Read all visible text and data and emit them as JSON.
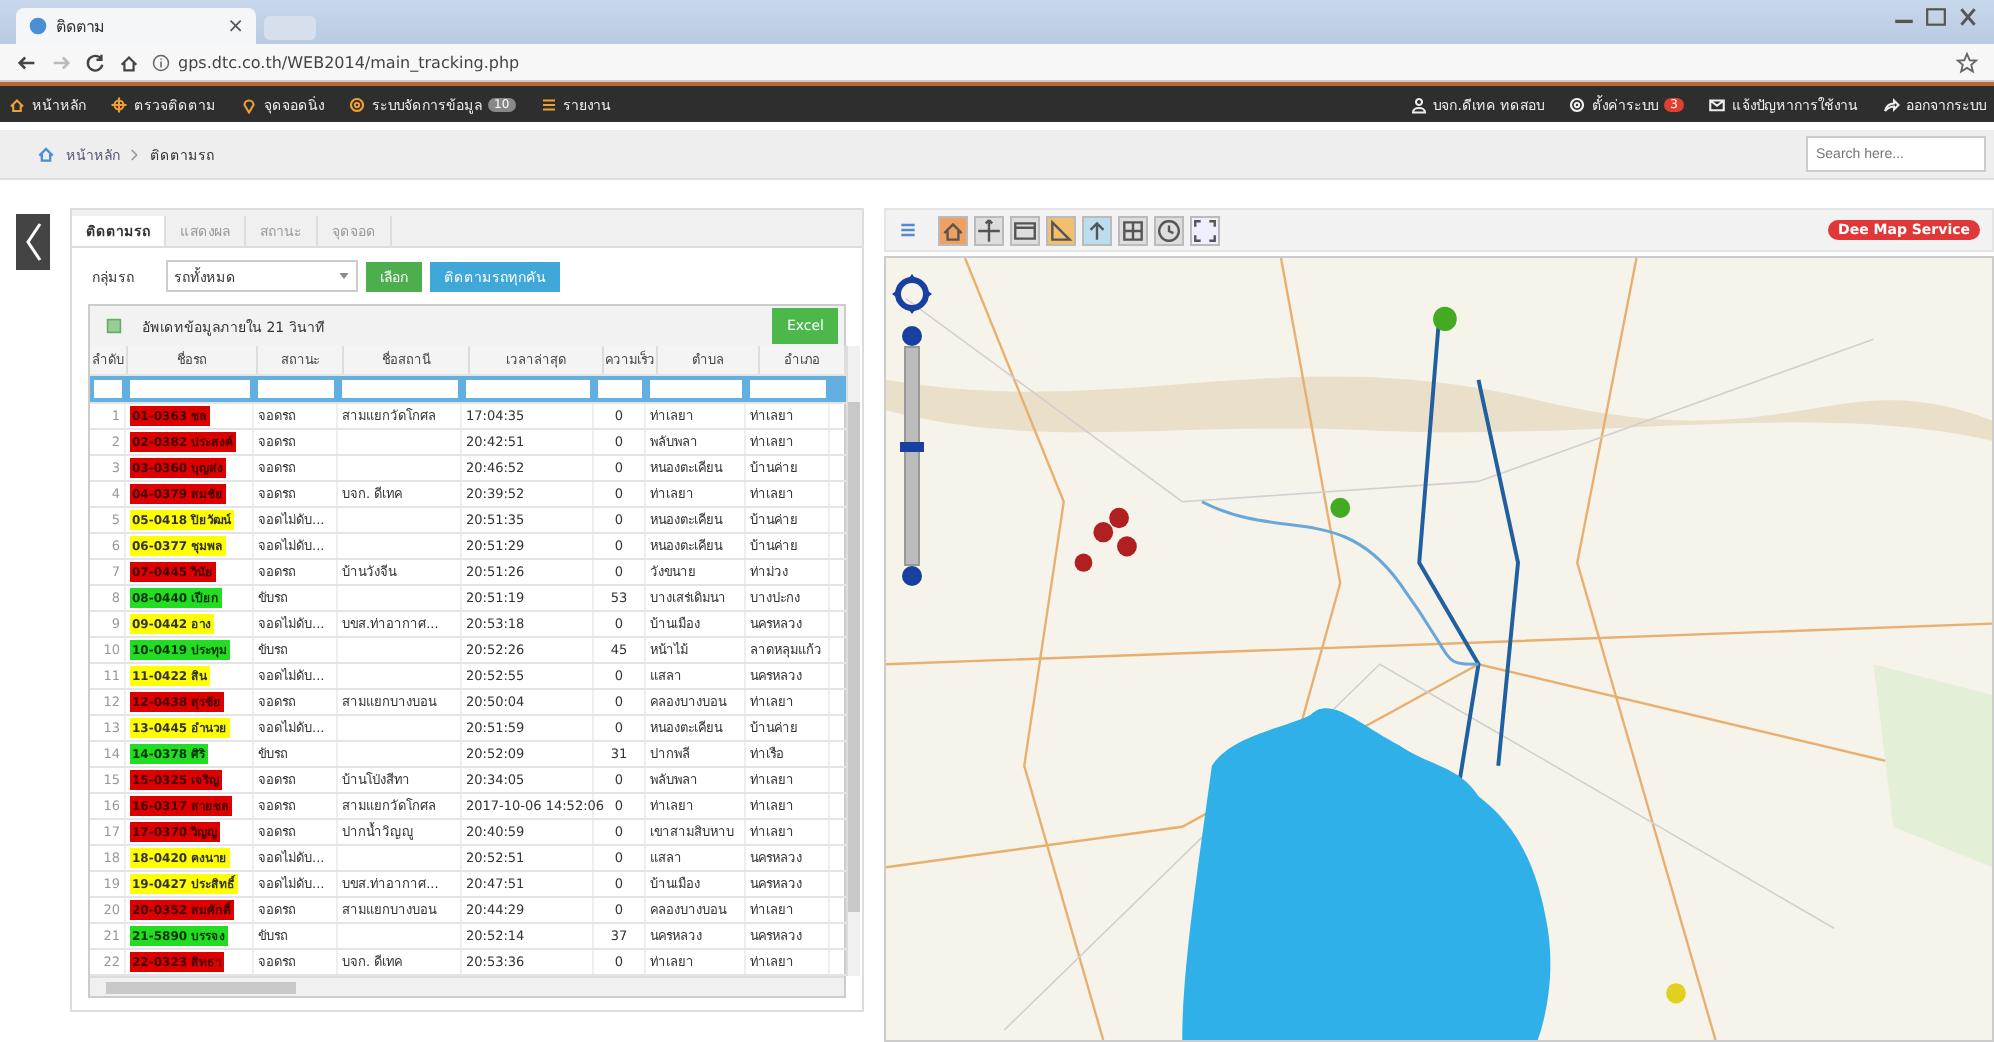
{
  "browser": {
    "tab_title": "ติดตาม",
    "tab_close": "×",
    "url": "gps.dtc.co.th/WEB2014/main_tracking.php"
  },
  "nav": {
    "left": [
      {
        "label": "หน้าหลัก"
      },
      {
        "label": "ตรวจติดตาม"
      },
      {
        "label": "จุดจอดนิ่ง"
      },
      {
        "label": "ระบบจัดการข้อมูล",
        "badge": "10"
      },
      {
        "label": "รายงาน"
      }
    ],
    "right": [
      {
        "label": "บจก.ดีเทค ทดสอบ"
      },
      {
        "label": "ตั้งค่าระบบ",
        "badge": "3"
      },
      {
        "label": "แจ้งปัญหาการใช้งาน"
      },
      {
        "label": "ออกจากระบบ"
      }
    ]
  },
  "breadcrumb": [
    "หน้าหลัก",
    "ติดตามรถ"
  ],
  "search": {
    "placeholder": "Search here..."
  },
  "panel": {
    "tabs": [
      {
        "label": "ติดตามรถ",
        "selected": true
      },
      {
        "label": "แสดงผล",
        "selected": false
      },
      {
        "label": "สถานะ",
        "selected": false
      },
      {
        "label": "จุดจอด",
        "selected": false
      }
    ],
    "group_label": "กลุ่มรถ",
    "group_value": "รถทั้งหมด",
    "select_button": "เลือก",
    "track_button": "ติดตามรถทุกคัน",
    "update_text": "อัพเดทข้อมูลภายใน 21 วินาที",
    "excel_button": "Excel",
    "columns": [
      "ลำดับ",
      "ชื่อรถ",
      "สถานะ",
      "ชื่อสถานี",
      "เวลาล่าสุด",
      "ความเร็ว",
      "ตำบล",
      "อำเภอ"
    ],
    "rows": [
      {
        "no": "1",
        "plate": "01-0363 ชล",
        "color": "#dd0000",
        "status": "จอดรถ",
        "station": "สามแยกวัดโกศล",
        "time": "17:04:35",
        "speed": "0",
        "tambon": "ท่าเลยา",
        "amphoe": "ท่าเลยา"
      },
      {
        "no": "2",
        "plate": "02-0382 ประสงค์",
        "color": "#dd0000",
        "status": "จอดรถ",
        "station": "",
        "time": "20:42:51",
        "speed": "0",
        "tambon": "พลับพลา",
        "amphoe": "ท่าเลยา"
      },
      {
        "no": "3",
        "plate": "03-0360 บุญส่ง",
        "color": "#dd0000",
        "status": "จอดรถ",
        "station": "",
        "time": "20:46:52",
        "speed": "0",
        "tambon": "หนองตะเคียน",
        "amphoe": "บ้านค่าย"
      },
      {
        "no": "4",
        "plate": "04-0379 สมชัย",
        "color": "#dd0000",
        "status": "จอดรถ",
        "station": "บจก. ดีเทค",
        "time": "20:39:52",
        "speed": "0",
        "tambon": "ท่าเลยา",
        "amphoe": "ท่าเลยา"
      },
      {
        "no": "5",
        "plate": "05-0418 ปิยวัฒน์",
        "color": "#ffff00",
        "status": "จอดไม่ดับ...",
        "station": "",
        "time": "20:51:35",
        "speed": "0",
        "tambon": "หนองตะเคียน",
        "amphoe": "บ้านค่าย"
      },
      {
        "no": "6",
        "plate": "06-0377 ชุมพล",
        "color": "#ffff00",
        "status": "จอดไม่ดับ...",
        "station": "",
        "time": "20:51:29",
        "speed": "0",
        "tambon": "หนองตะเคียน",
        "amphoe": "บ้านค่าย"
      },
      {
        "no": "7",
        "plate": "07-0445 วินัย",
        "color": "#dd0000",
        "status": "จอดรถ",
        "station": "บ้านวังจีน",
        "time": "20:51:26",
        "speed": "0",
        "tambon": "วังขนาย",
        "amphoe": "ท่าม่วง"
      },
      {
        "no": "8",
        "plate": "08-0440 เปียก",
        "color": "#22dd22",
        "status": "ขับรถ",
        "station": "",
        "time": "20:51:19",
        "speed": "53",
        "tambon": "บางเสร่เดิมนา",
        "amphoe": "บางปะกง"
      },
      {
        "no": "9",
        "plate": "09-0442 อาง",
        "color": "#ffff00",
        "status": "จอดไม่ดับ...",
        "station": "บขส.ท่าอากาศ...",
        "time": "20:53:18",
        "speed": "0",
        "tambon": "บ้านเมือง",
        "amphoe": "นครหลวง"
      },
      {
        "no": "10",
        "plate": "10-0419 ประทุม",
        "color": "#22dd22",
        "status": "ขับรถ",
        "station": "",
        "time": "20:52:26",
        "speed": "45",
        "tambon": "หน้าไม้",
        "amphoe": "ลาดหลุมแก้ว"
      },
      {
        "no": "11",
        "plate": "11-0422 สิน",
        "color": "#ffff00",
        "status": "จอดไม่ดับ...",
        "station": "",
        "time": "20:52:55",
        "speed": "0",
        "tambon": "แสลา",
        "amphoe": "นครหลวง"
      },
      {
        "no": "12",
        "plate": "12-0438 สุรชัย",
        "color": "#dd0000",
        "status": "จอดรถ",
        "station": "สามแยกบางบอน",
        "time": "20:50:04",
        "speed": "0",
        "tambon": "คลองบางบอน",
        "amphoe": "ท่าเลยา"
      },
      {
        "no": "13",
        "plate": "13-0445 อำนวย",
        "color": "#ffff00",
        "status": "จอดไม่ดับ...",
        "station": "",
        "time": "20:51:59",
        "speed": "0",
        "tambon": "หนองตะเคียน",
        "amphoe": "บ้านค่าย"
      },
      {
        "no": "14",
        "plate": "14-0378 ศิริ",
        "color": "#22dd22",
        "status": "ขับรถ",
        "station": "",
        "time": "20:52:09",
        "speed": "31",
        "tambon": "ปากพลี",
        "amphoe": "ท่าเรือ"
      },
      {
        "no": "15",
        "plate": "15-0325 เจริญ",
        "color": "#dd0000",
        "status": "จอดรถ",
        "station": "บ้านโป่งสีทา",
        "time": "20:34:05",
        "speed": "0",
        "tambon": "พลับพลา",
        "amphoe": "ท่าเลยา"
      },
      {
        "no": "16",
        "plate": "16-0317 สายชล",
        "color": "#dd0000",
        "status": "จอดรถ",
        "station": "สามแยกวัดโกศล",
        "time": "2017-10-06 14:52:06",
        "speed": "0",
        "tambon": "ท่าเลยา",
        "amphoe": "ท่าเลยา"
      },
      {
        "no": "17",
        "plate": "17-0370 วิญญู",
        "color": "#dd0000",
        "status": "จอดรถ",
        "station": "ปากน้ำวิญญู",
        "time": "20:40:59",
        "speed": "0",
        "tambon": "เขาสามสิบหาบ",
        "amphoe": "ท่าเลยา"
      },
      {
        "no": "18",
        "plate": "18-0420 คงนาย",
        "color": "#ffff00",
        "status": "จอดไม่ดับ...",
        "station": "",
        "time": "20:52:51",
        "speed": "0",
        "tambon": "แสลา",
        "amphoe": "นครหลวง"
      },
      {
        "no": "19",
        "plate": "19-0427 ประสิทธิ์",
        "color": "#ffff00",
        "status": "จอดไม่ดับ...",
        "station": "บขส.ท่าอากาศ...",
        "time": "20:47:51",
        "speed": "0",
        "tambon": "บ้านเมือง",
        "amphoe": "นครหลวง"
      },
      {
        "no": "20",
        "plate": "20-0352 สมศักดิ์",
        "color": "#dd0000",
        "status": "จอดรถ",
        "station": "สามแยกบางบอน",
        "time": "20:44:29",
        "speed": "0",
        "tambon": "คลองบางบอน",
        "amphoe": "ท่าเลยา"
      },
      {
        "no": "21",
        "plate": "21-5890 บรรจง",
        "color": "#22dd22",
        "status": "ขับรถ",
        "station": "",
        "time": "20:52:14",
        "speed": "37",
        "tambon": "นครหลวง",
        "amphoe": "นครหลวง"
      },
      {
        "no": "22",
        "plate": "22-0323 สิทธา",
        "color": "#dd0000",
        "status": "จอดรถ",
        "station": "บจก. ดีเทค",
        "time": "20:53:36",
        "speed": "0",
        "tambon": "ท่าเลยา",
        "amphoe": "ท่าเลยา"
      }
    ]
  },
  "map": {
    "service_badge": "Dee Map Service",
    "zoom": {
      "level": 0.55
    }
  }
}
